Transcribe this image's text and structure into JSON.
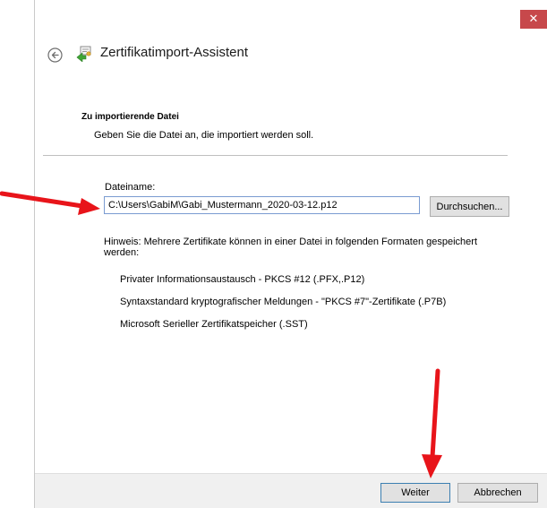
{
  "window": {
    "close_symbol": "✕",
    "title": "Zertifikatimport-Assistent",
    "back_icon": "back-arrow-icon",
    "wizard_icon": "certificate-icon"
  },
  "section": {
    "title": "Zu importierende Datei",
    "description": "Geben Sie die Datei an, die importiert werden soll."
  },
  "file": {
    "label": "Dateiname:",
    "value": "C:\\Users\\GabiM\\Gabi_Mustermann_2020-03-12.p12",
    "browse_label": "Durchsuchen..."
  },
  "hint": {
    "text": "Hinweis: Mehrere Zertifikate können in einer Datei in folgenden Formaten gespeichert werden:",
    "formats": [
      "Privater Informationsaustausch - PKCS #12 (.PFX,.P12)",
      "Syntaxstandard kryptografischer Meldungen - \"PKCS #7\"-Zertifikate (.P7B)",
      "Microsoft Serieller Zertifikatspeicher (.SST)"
    ]
  },
  "footer": {
    "next_label": "Weiter",
    "cancel_label": "Abbrechen"
  },
  "colors": {
    "close_button": "#c7484b",
    "annotation_arrow": "#e8141a",
    "input_border": "#7a9bd1",
    "footer_bg": "#f0f0f0"
  }
}
